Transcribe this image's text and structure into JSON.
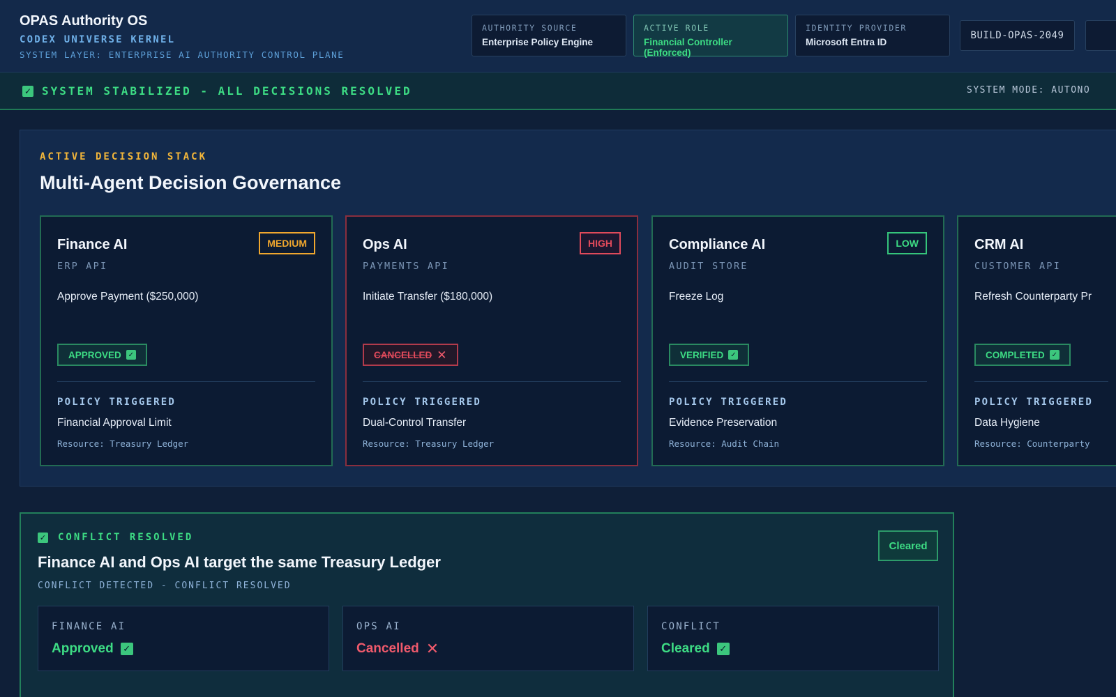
{
  "header": {
    "title": "OPAS Authority OS",
    "subtitle": "CODEX UNIVERSE KERNEL",
    "layer": "SYSTEM LAYER: ENTERPRISE AI AUTHORITY CONTROL PLANE",
    "boxes": [
      {
        "label": "AUTHORITY SOURCE",
        "value": "Enterprise Policy Engine"
      },
      {
        "label": "ACTIVE ROLE",
        "value": "Financial Controller (Enforced)"
      },
      {
        "label": "IDENTITY PROVIDER",
        "value": "Microsoft Entra ID"
      }
    ],
    "build": "BUILD-OPAS-2049"
  },
  "status": {
    "message": "SYSTEM STABILIZED - ALL DECISIONS RESOLVED",
    "mode": "SYSTEM MODE: AUTONO"
  },
  "stack": {
    "eyebrow": "ACTIVE DECISION STACK",
    "title": "Multi-Agent Decision Governance",
    "policy_heading": "POLICY TRIGGERED",
    "cards": [
      {
        "name": "Finance AI",
        "api": "ERP API",
        "risk": "MEDIUM",
        "action": "Approve Payment ($250,000)",
        "state": "APPROVED",
        "policy": "Financial Approval Limit",
        "resource": "Resource: Treasury Ledger"
      },
      {
        "name": "Ops AI",
        "api": "PAYMENTS API",
        "risk": "HIGH",
        "action": "Initiate Transfer ($180,000)",
        "state": "CANCELLED",
        "policy": "Dual-Control Transfer",
        "resource": "Resource: Treasury Ledger"
      },
      {
        "name": "Compliance AI",
        "api": "AUDIT STORE",
        "risk": "LOW",
        "action": "Freeze Log",
        "state": "VERIFIED",
        "policy": "Evidence Preservation",
        "resource": "Resource: Audit Chain"
      },
      {
        "name": "CRM AI",
        "api": "CUSTOMER API",
        "risk": "",
        "action": "Refresh Counterparty Pr",
        "state": "COMPLETED",
        "policy": "Data Hygiene",
        "resource": "Resource: Counterparty"
      }
    ]
  },
  "conflict": {
    "eyebrow": "CONFLICT RESOLVED",
    "title": "Finance AI and Ops AI target the same Treasury Ledger",
    "subtitle": "CONFLICT DETECTED - CONFLICT RESOLVED",
    "button": "Cleared",
    "outcomes": [
      {
        "label": "FINANCE AI",
        "value": "Approved"
      },
      {
        "label": "OPS AI",
        "value": "Cancelled"
      },
      {
        "label": "CONFLICT",
        "value": "Cleared"
      }
    ]
  },
  "colors": {
    "success": "#3ddc84",
    "danger": "#e04a5b",
    "warning": "#f0a72e",
    "accent_blue": "#6fb0e8",
    "background": "#0f1f38"
  },
  "icons": {
    "check": "check-icon",
    "cross": "x-icon"
  }
}
